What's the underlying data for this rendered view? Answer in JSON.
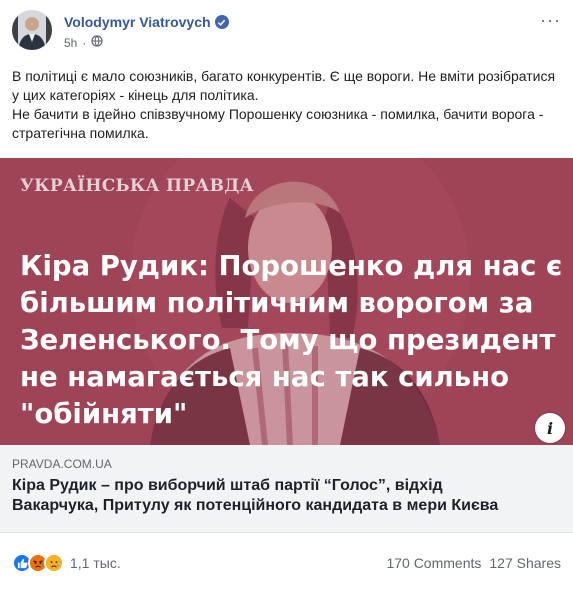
{
  "post": {
    "author": "Volodymyr Viatrovych",
    "time": "5h",
    "dot": "·",
    "menu": "···",
    "text_lines": [
      "В політиці є мало союзників, багато конкурентів. Є ще вороги. Не вміти розібратися у цих категоріях - кінець для політика.",
      "Не бачити в ідейно співзвучному Порошенку союзника - помилка, бачити ворога - стратегічна помилка."
    ]
  },
  "hero": {
    "brand": "УКРАЇНСЬКА ПРАВДА",
    "headline_lines": [
      "Кіра Рудик: Порошенко для нас є",
      "більшим політичним ворогом за",
      "Зеленського. Тому що президент",
      "не намагається нас так сильно",
      "\"обійняти\""
    ],
    "info": "i"
  },
  "link": {
    "domain": "PRAVDA.COM.UA",
    "title_lines": [
      "Кіра Рудик – про виборчий штаб партії “Голос”, відхід",
      "Вакарчука, Притулу як потенційного кандидата в мери Києва"
    ]
  },
  "footer": {
    "reactions_count": "1,1 тыс.",
    "comments": "170 Comments",
    "shares": "127 Shares"
  },
  "colors": {
    "author_link": "#385898",
    "hero_tint": "#9f4356",
    "like": "#1877f2",
    "angry": "#e9710f",
    "sad": "#f7b125"
  },
  "icons": [
    "verified-badge-icon",
    "globe-icon",
    "more-menu-icon",
    "info-icon",
    "like-reaction-icon",
    "angry-reaction-icon",
    "sad-reaction-icon"
  ]
}
